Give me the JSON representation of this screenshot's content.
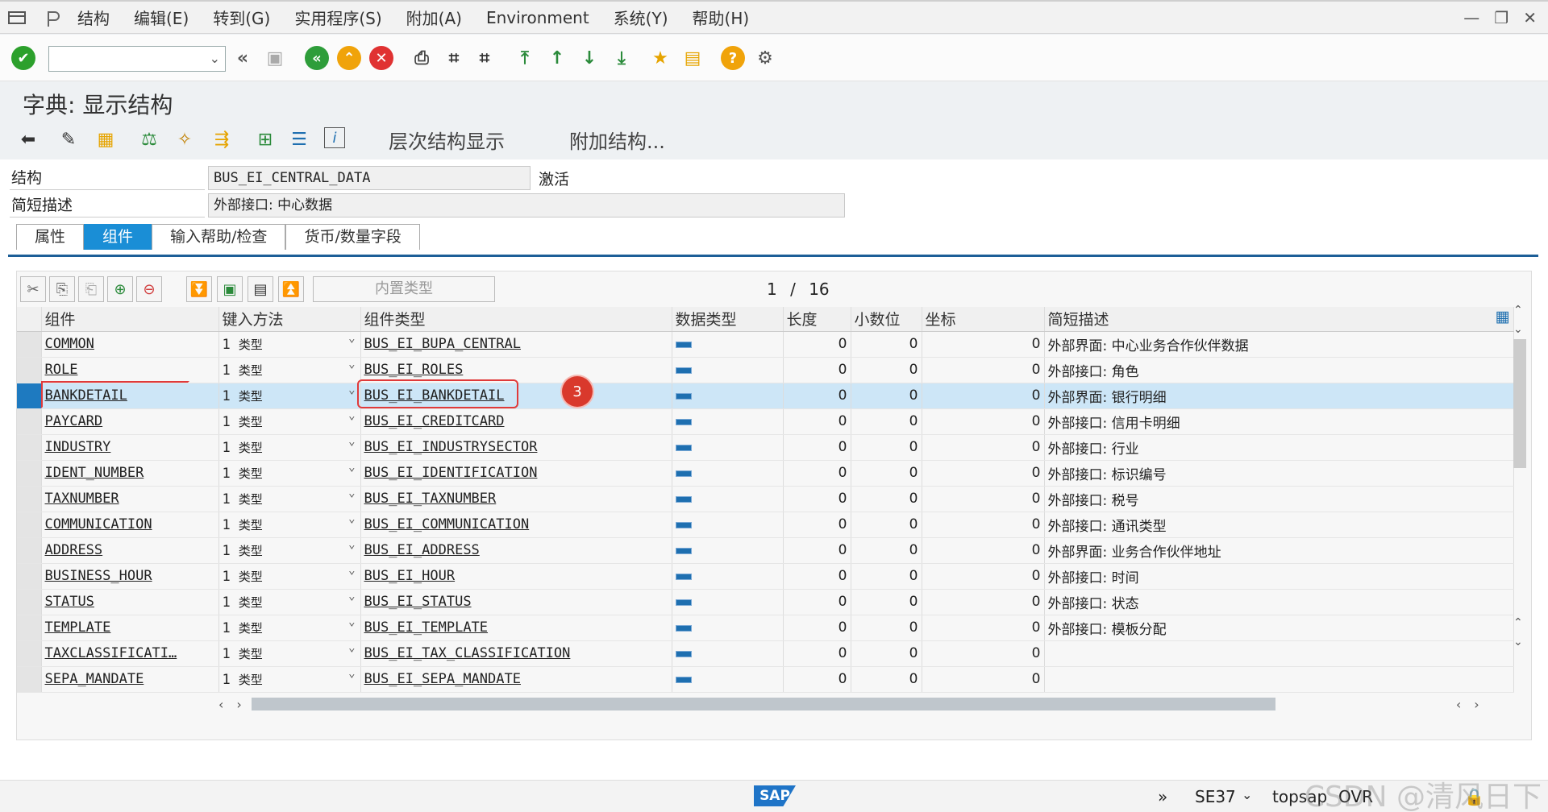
{
  "menu": {
    "items": [
      "结构",
      "编辑(E)",
      "转到(G)",
      "实用程序(S)",
      "附加(A)",
      "Environment",
      "系统(Y)",
      "帮助(H)"
    ]
  },
  "toolbar": {
    "command_value": ""
  },
  "title": "字典: 显示结构",
  "app_toolbar": {
    "hierarchy_label": "层次结构显示",
    "append_label": "附加结构..."
  },
  "structure": {
    "label": "结构",
    "value": "BUS_EI_CENTRAL_DATA",
    "status": "激活",
    "desc_label": "简短描述",
    "desc_value": "外部接口: 中心数据"
  },
  "tabs": [
    "属性",
    "组件",
    "输入帮助/检查",
    "货币/数量字段"
  ],
  "grid": {
    "builtin_type_label": "内置类型",
    "pager_current": "1",
    "pager_sep": "/",
    "pager_total": "16",
    "headers": [
      "组件",
      "键入方法",
      "组件类型",
      "数据类型",
      "长度",
      "小数位",
      "坐标",
      "简短描述"
    ],
    "rows": [
      {
        "comp": "COMMON",
        "key": "1",
        "keytype": "类型",
        "ctype": "BUS_EI_BUPA_CENTRAL",
        "len": "0",
        "dec": "0",
        "coord": "0",
        "desc": "外部界面: 中心业务合作伙伴数据"
      },
      {
        "comp": "ROLE",
        "key": "1",
        "keytype": "类型",
        "ctype": "BUS_EI_ROLES",
        "len": "0",
        "dec": "0",
        "coord": "0",
        "desc": "外部接口: 角色"
      },
      {
        "comp": "BANKDETAIL",
        "key": "1",
        "keytype": "类型",
        "ctype": "BUS_EI_BANKDETAIL",
        "len": "0",
        "dec": "0",
        "coord": "0",
        "desc": "外部界面: 银行明细"
      },
      {
        "comp": "PAYCARD",
        "key": "1",
        "keytype": "类型",
        "ctype": "BUS_EI_CREDITCARD",
        "len": "0",
        "dec": "0",
        "coord": "0",
        "desc": "外部接口: 信用卡明细"
      },
      {
        "comp": "INDUSTRY",
        "key": "1",
        "keytype": "类型",
        "ctype": "BUS_EI_INDUSTRYSECTOR",
        "len": "0",
        "dec": "0",
        "coord": "0",
        "desc": "外部接口: 行业"
      },
      {
        "comp": "IDENT_NUMBER",
        "key": "1",
        "keytype": "类型",
        "ctype": "BUS_EI_IDENTIFICATION",
        "len": "0",
        "dec": "0",
        "coord": "0",
        "desc": "外部接口: 标识编号"
      },
      {
        "comp": "TAXNUMBER",
        "key": "1",
        "keytype": "类型",
        "ctype": "BUS_EI_TAXNUMBER",
        "len": "0",
        "dec": "0",
        "coord": "0",
        "desc": "外部接口: 税号"
      },
      {
        "comp": "COMMUNICATION",
        "key": "1",
        "keytype": "类型",
        "ctype": "BUS_EI_COMMUNICATION",
        "len": "0",
        "dec": "0",
        "coord": "0",
        "desc": "外部接口: 通讯类型"
      },
      {
        "comp": "ADDRESS",
        "key": "1",
        "keytype": "类型",
        "ctype": "BUS_EI_ADDRESS",
        "len": "0",
        "dec": "0",
        "coord": "0",
        "desc": "外部界面: 业务合作伙伴地址"
      },
      {
        "comp": "BUSINESS_HOUR",
        "key": "1",
        "keytype": "类型",
        "ctype": "BUS_EI_HOUR",
        "len": "0",
        "dec": "0",
        "coord": "0",
        "desc": "外部接口: 时间"
      },
      {
        "comp": "STATUS",
        "key": "1",
        "keytype": "类型",
        "ctype": "BUS_EI_STATUS",
        "len": "0",
        "dec": "0",
        "coord": "0",
        "desc": "外部接口: 状态"
      },
      {
        "comp": "TEMPLATE",
        "key": "1",
        "keytype": "类型",
        "ctype": "BUS_EI_TEMPLATE",
        "len": "0",
        "dec": "0",
        "coord": "0",
        "desc": "外部接口: 模板分配"
      },
      {
        "comp": "TAXCLASSIFICATI…",
        "key": "1",
        "keytype": "类型",
        "ctype": "BUS_EI_TAX_CLASSIFICATION",
        "len": "0",
        "dec": "0",
        "coord": "0",
        "desc": ""
      },
      {
        "comp": "SEPA_MANDATE",
        "key": "1",
        "keytype": "类型",
        "ctype": "BUS_EI_SEPA_MANDATE",
        "len": "0",
        "dec": "0",
        "coord": "0",
        "desc": ""
      }
    ],
    "active_row": 2,
    "badge": "3"
  },
  "status": {
    "tcode": "SE37",
    "system": "topsap",
    "mode": "OVR"
  },
  "watermark": "CSDN @清风日下",
  "colors": {
    "accent": "#1a8ed6",
    "selected_row": "#cde6f7",
    "badge": "#d9392c"
  }
}
